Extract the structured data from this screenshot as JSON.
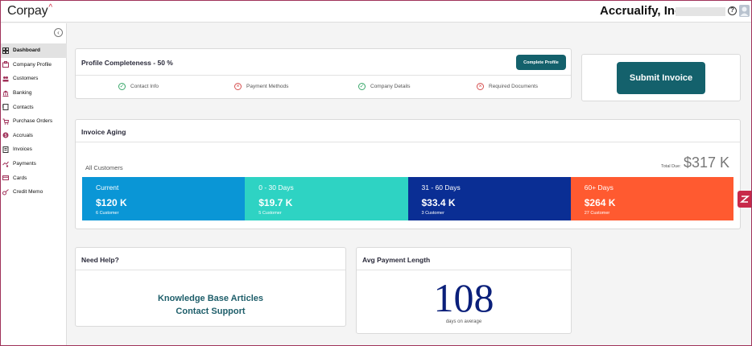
{
  "header": {
    "logo": "Corpay",
    "company_name": "Accrualify, Inc."
  },
  "sidebar": {
    "items": [
      {
        "label": "Dashboard",
        "icon": "dashboard-icon",
        "active": true
      },
      {
        "label": "Company Profile",
        "icon": "company-icon"
      },
      {
        "label": "Customers",
        "icon": "customers-icon"
      },
      {
        "label": "Banking",
        "icon": "bank-icon"
      },
      {
        "label": "Contacts",
        "icon": "contacts-icon"
      },
      {
        "label": "Purchase Orders",
        "icon": "purchase-orders-icon"
      },
      {
        "label": "Accruals",
        "icon": "accruals-icon"
      },
      {
        "label": "Invoices",
        "icon": "invoices-icon"
      },
      {
        "label": "Payments",
        "icon": "payments-icon"
      },
      {
        "label": "Cards",
        "icon": "cards-icon"
      },
      {
        "label": "Credit Memo",
        "icon": "credit-memo-icon"
      }
    ]
  },
  "profile": {
    "title": "Profile Completeness - 50 %",
    "button": "Complete Profile",
    "items": [
      {
        "label": "Contact Info",
        "done": true
      },
      {
        "label": "Payment Methods",
        "done": false
      },
      {
        "label": "Company Details",
        "done": true
      },
      {
        "label": "Required Documents",
        "done": false
      }
    ]
  },
  "submit": {
    "label": "Submit Invoice"
  },
  "aging": {
    "title": "Invoice Aging",
    "filter_label": "All Customers",
    "total_label": "Total Due:",
    "total_value": "$317 K",
    "segments": [
      {
        "label": "Current",
        "amount": "$120 K",
        "count": "6 Customer",
        "color": "#0a96d6"
      },
      {
        "label": "0 - 30 Days",
        "amount": "$19.7 K",
        "count": "5 Customer",
        "color": "#2ed3c3"
      },
      {
        "label": "31 - 60 Days",
        "amount": "$33.4 K",
        "count": "3 Customer",
        "color": "#0a2e94"
      },
      {
        "label": "60+ Days",
        "amount": "$264 K",
        "count": "27 Customer",
        "color": "#ff5a30"
      }
    ]
  },
  "help": {
    "title": "Need Help?",
    "link1": "Knowledge Base Articles",
    "link2": "Contact Support"
  },
  "avg_payment": {
    "title": "Avg Payment Length",
    "value": "108",
    "caption": "days on average"
  },
  "colors": {
    "teal": "#14616c",
    "accent_red": "#c8294a",
    "value_blue": "#0a1f7a"
  }
}
